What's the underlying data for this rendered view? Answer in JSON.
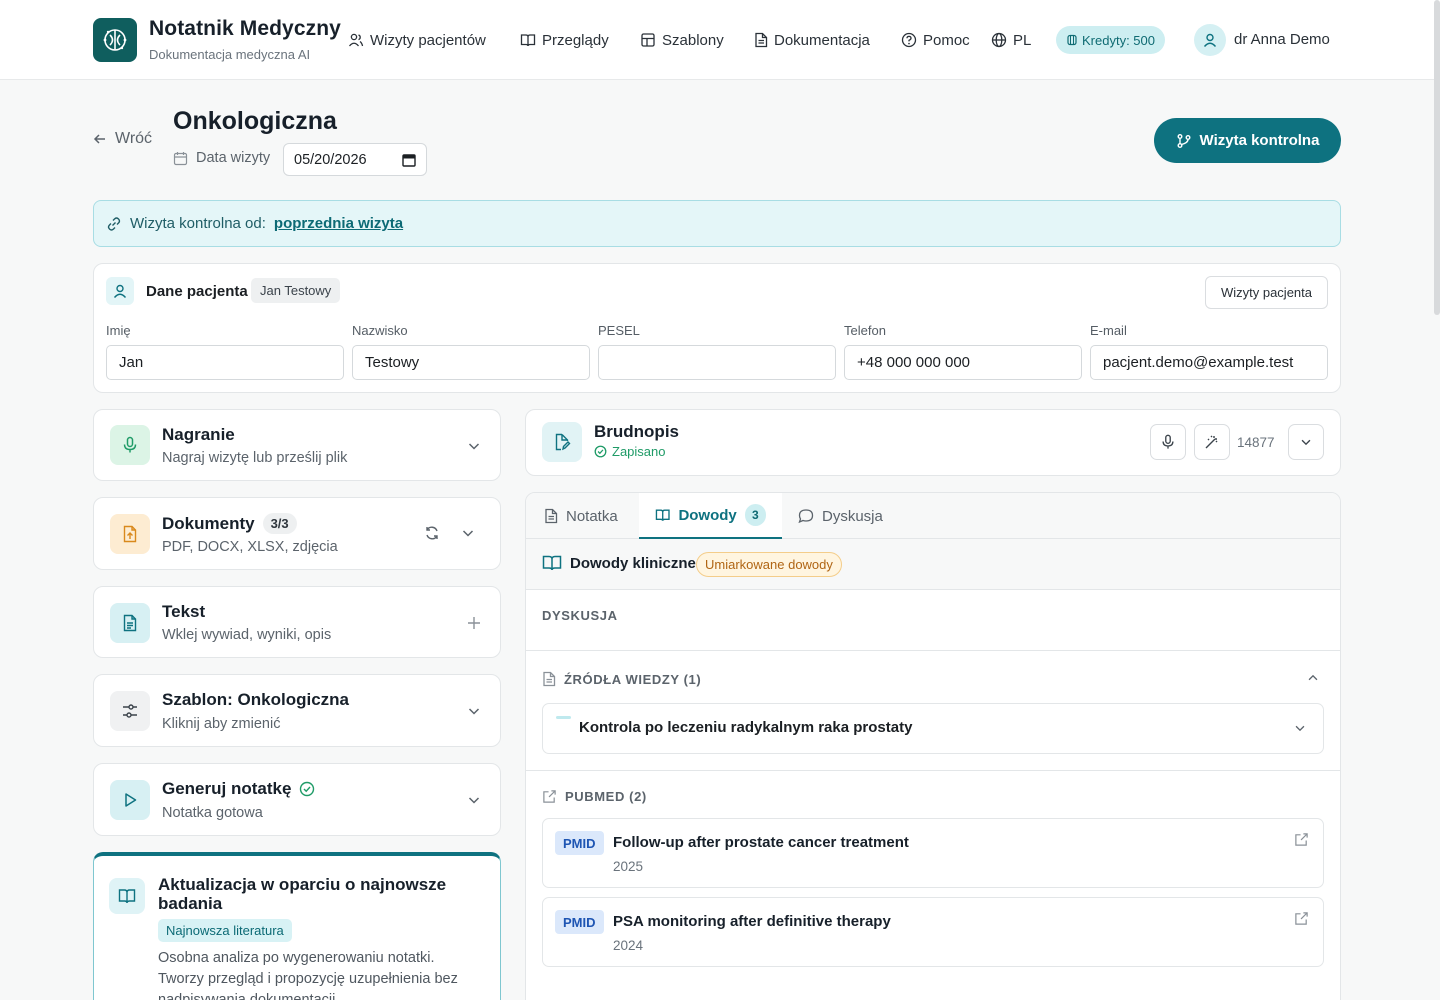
{
  "header": {
    "brand_title": "Notatnik Medyczny",
    "brand_subtitle": "Dokumentacja medyczna AI",
    "nav": [
      {
        "label": "Wizyty pacjentów",
        "icon": "users-icon"
      },
      {
        "label": "Przeglądy",
        "icon": "book-icon"
      },
      {
        "label": "Szablony",
        "icon": "template-icon"
      },
      {
        "label": "Dokumentacja",
        "icon": "document-icon"
      },
      {
        "label": "Pomoc",
        "icon": "help-icon"
      },
      {
        "label": "PL",
        "icon": "globe-icon"
      }
    ],
    "credits": "Kredyty: 500",
    "user_name": "dr Anna Demo"
  },
  "page": {
    "back_label": "Wróć",
    "title": "Onkologiczna",
    "date_label": "Data wizyty",
    "date_value": "05/20/2026",
    "primary_button": "Wizyta kontrolna"
  },
  "banner": {
    "text": "Wizyta kontrolna od:",
    "link": "poprzednia wizyta"
  },
  "patient": {
    "title": "Dane pacjenta",
    "badge": "Jan Testowy",
    "visits_button": "Wizyty pacjenta",
    "fields": [
      {
        "label": "Imię",
        "value": "Jan"
      },
      {
        "label": "Nazwisko",
        "value": "Testowy"
      },
      {
        "label": "PESEL",
        "value": ""
      },
      {
        "label": "Telefon",
        "value": "+48 000 000 000"
      },
      {
        "label": "E-mail",
        "value": "pacjent.demo@example.test"
      }
    ]
  },
  "panels": {
    "recording": {
      "title": "Nagranie",
      "subtitle": "Nagraj wizytę lub prześlij plik"
    },
    "documents": {
      "title": "Dokumenty",
      "count": "3/3",
      "subtitle": "PDF, DOCX, XLSX, zdjęcia"
    },
    "text": {
      "title": "Tekst",
      "subtitle": "Wklej wywiad, wyniki, opis"
    },
    "template": {
      "title": "Szablon: Onkologiczna",
      "subtitle": "Kliknij aby zmienić"
    },
    "generate": {
      "title": "Generuj notatkę",
      "subtitle": "Notatka gotowa"
    },
    "research": {
      "title": "Aktualizacja w oparciu o najnowsze badania",
      "badge": "Najnowsza literatura",
      "description": "Osobna analiza po wygenerowaniu notatki. Tworzy przegląd i propozycję uzupełnienia bez nadpisywania dokumentacji."
    }
  },
  "draft": {
    "title": "Brudnopis",
    "status": "Zapisano",
    "count": "14877"
  },
  "tabs": [
    {
      "label": "Notatka"
    },
    {
      "label": "Dowody",
      "badge": "3"
    },
    {
      "label": "Dyskusja"
    }
  ],
  "evidence": {
    "title": "Dowody kliniczne",
    "level": "Umiarkowane dowody",
    "discussion_label": "DYSKUSJA",
    "sources_label": "ŹRÓDŁA WIEDZY (1)",
    "sources": [
      {
        "title": "Kontrola po leczeniu radykalnym raka prostaty"
      }
    ],
    "pubmed_label": "PUBMED (2)",
    "pubmed": [
      {
        "tag": "PMID",
        "title": "Follow-up after prostate cancer treatment",
        "year": "2025"
      },
      {
        "tag": "PMID",
        "title": "PSA monitoring after definitive therapy",
        "year": "2024"
      }
    ]
  },
  "colors": {
    "brand": "#0f5e5e",
    "accent": "#0e7280",
    "success": "#1f9b67",
    "warning": "#b06514"
  }
}
